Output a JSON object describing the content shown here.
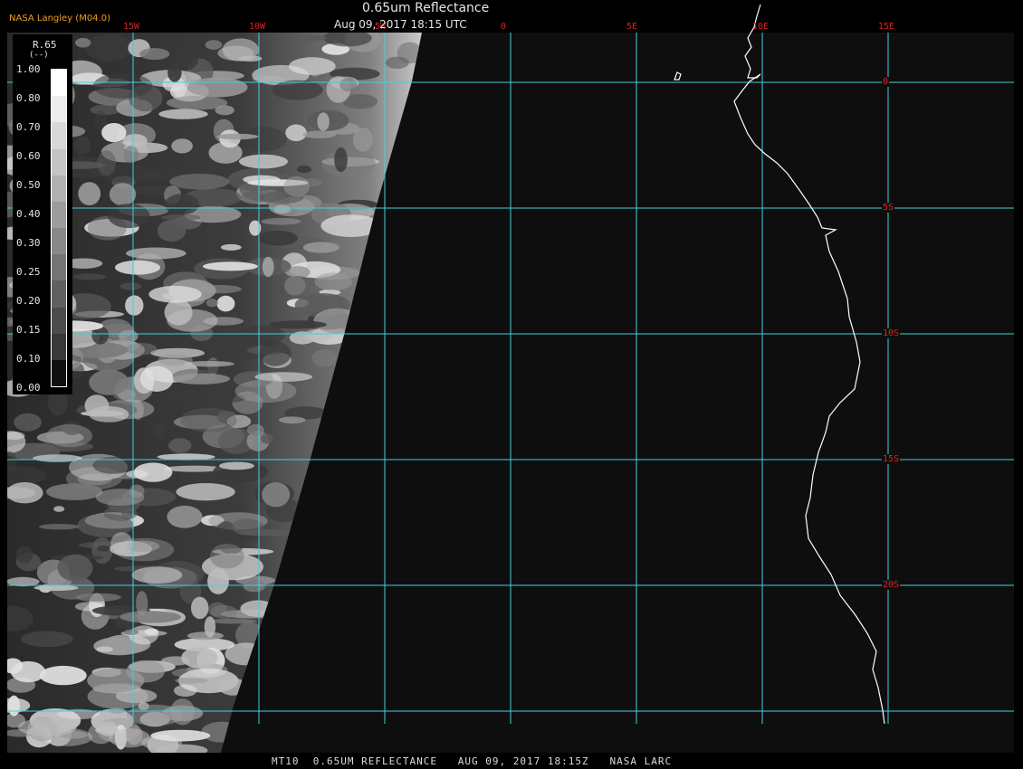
{
  "header": {
    "credit": "NASA Langley (M04.0)",
    "title": "0.65um Reflectance",
    "datetime": "Aug 09, 2017 18:15 UTC"
  },
  "footer": {
    "text": "MT10  0.65UM REFLECTANCE   AUG 09, 2017 18:15Z   NASA LARC"
  },
  "colorbar": {
    "variable": "R.65",
    "unit": "(--)",
    "ticks": [
      "1.00",
      "0.80",
      "0.70",
      "0.60",
      "0.50",
      "0.40",
      "0.30",
      "0.25",
      "0.20",
      "0.15",
      "0.10",
      "0.00"
    ],
    "segments": [
      "#ffffff",
      "#ececec",
      "#d8d8d8",
      "#c4c4c4",
      "#b0b0b0",
      "#9c9c9c",
      "#888888",
      "#747474",
      "#606060",
      "#4c4c4c",
      "#383838",
      "#101010"
    ]
  },
  "grid": {
    "color": "#40d0e0",
    "longitudes": [
      {
        "label": "15W",
        "lon": -15
      },
      {
        "label": "10W",
        "lon": -10
      },
      {
        "label": "5W",
        "lon": -5
      },
      {
        "label": "0",
        "lon": 0
      },
      {
        "label": "5E",
        "lon": 5
      },
      {
        "label": "10E",
        "lon": 10
      },
      {
        "label": "15E",
        "lon": 15
      }
    ],
    "latitudes": [
      {
        "label": "0",
        "lat": 0
      },
      {
        "label": "5S",
        "lat": -5
      },
      {
        "label": "10S",
        "lat": -10
      },
      {
        "label": "15S",
        "lat": -15
      },
      {
        "label": "20S",
        "lat": -20
      },
      {
        "label": "25S",
        "lat": -25
      }
    ]
  },
  "map": {
    "coastline_color": "#ffffff",
    "earth_color": "#0e0e0e",
    "cloud_palette": [
      "#3a3a3a",
      "#5a5a5a",
      "#7a7a7a",
      "#9a9a9a",
      "#bcbcbc",
      "#e0e0e0"
    ]
  }
}
